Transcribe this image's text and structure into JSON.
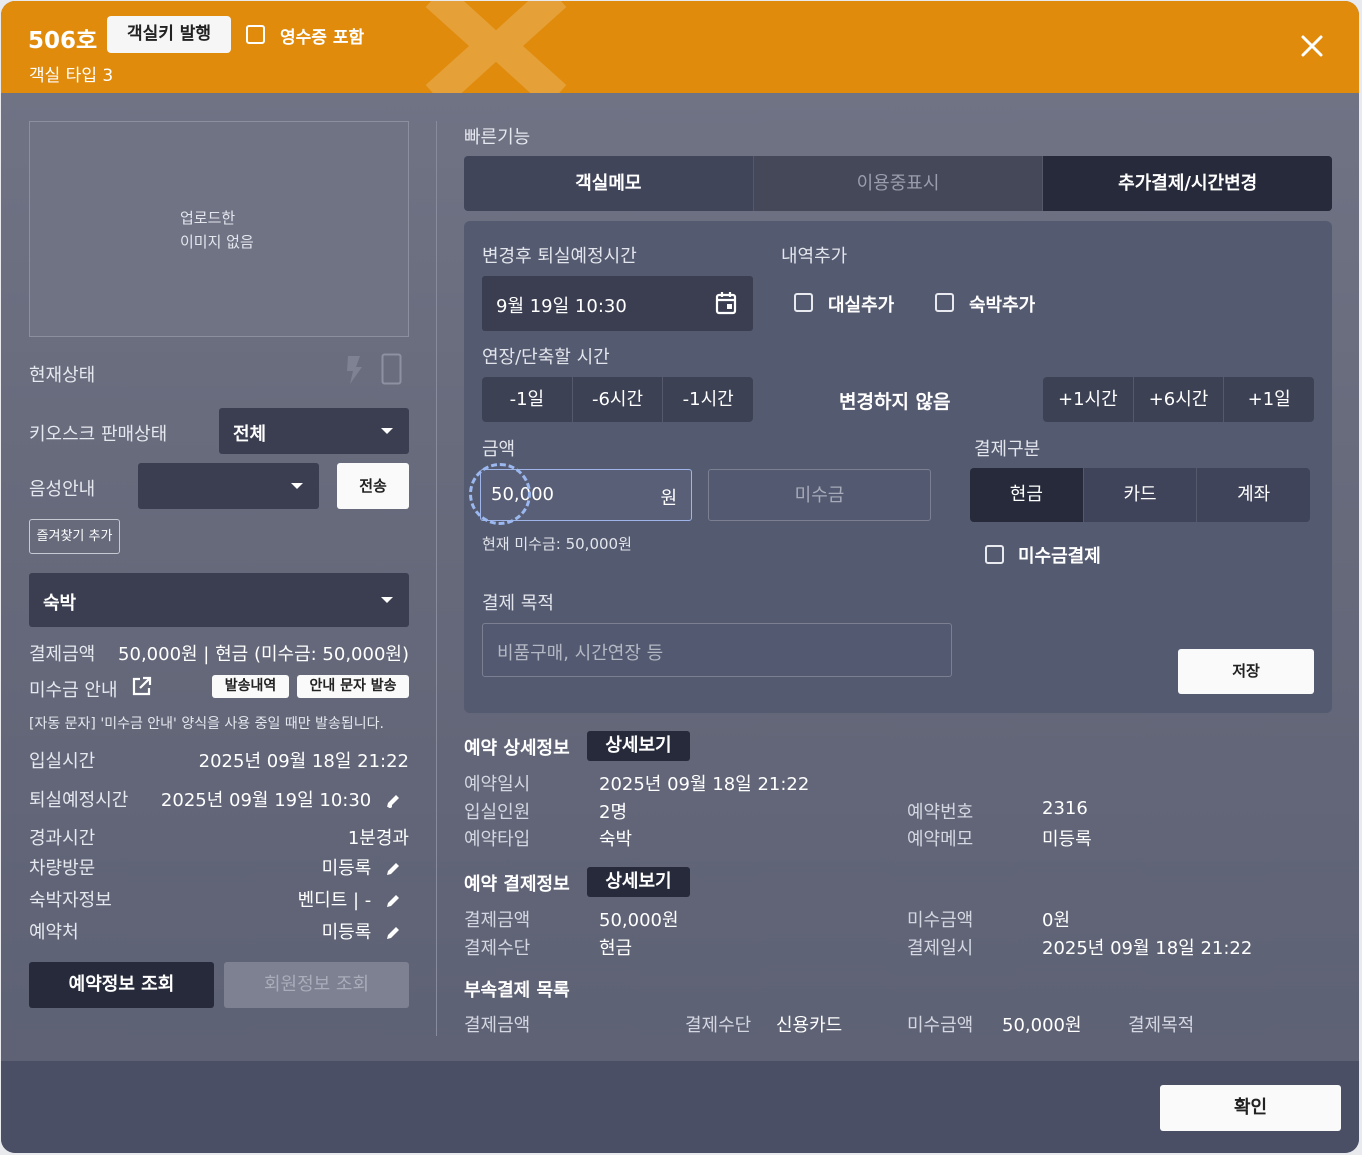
{
  "header": {
    "room_no": "506호",
    "issue_key_label": "객실키 발행",
    "receipt_label": "영수증 포함",
    "room_type": "객실 타입 3"
  },
  "left": {
    "image_placeholder": [
      "업로드한",
      "이미지 없음"
    ],
    "current_status_label": "현재상태",
    "kiosk_label": "키오스크 판매상태",
    "kiosk_value": "전체",
    "voice_label": "음성안내",
    "voice_value": "",
    "send_label": "전송",
    "favorite_label": "즐겨찾기 추가",
    "stay_type": "숙박",
    "payment_label": "결제금액",
    "payment_value": "50,000원 | 현금 (미수금: 50,000원)",
    "unpaid_notice_label": "미수금 안내",
    "send_history_label": "발송내역",
    "send_notice_label": "안내 문자 발송",
    "auto_sms_note": "[자동 문자] '미수금 안내' 양식을 사용 중일 때만 발송됩니다.",
    "checkin_label": "입실시간",
    "checkin_value": "2025년 09월 18일 21:22",
    "checkout_label": "퇴실예정시간",
    "checkout_value": "2025년 09월 19일 10:30",
    "elapsed_label": "경과시간",
    "elapsed_value": "1분경과",
    "vehicle_label": "차량방문",
    "vehicle_value": "미등록",
    "guest_label": "숙박자정보",
    "guest_value": "벤디트 | -",
    "channel_label": "예약처",
    "channel_value": "미등록",
    "reservation_btn": "예약정보 조회",
    "member_btn": "회원정보 조회"
  },
  "quick": {
    "title": "빠른기능",
    "tabs": [
      "객실메모",
      "이용중표시",
      "추가결제/시간변경"
    ],
    "checkout_after_label": "변경후 퇴실예정시간",
    "checkout_after_value": "9월 19일 10:30",
    "add_history_label": "내역추가",
    "add_rent_label": "대실추가",
    "add_stay_label": "숙박추가",
    "extend_label": "연장/단축할 시간",
    "minus_options": [
      "-1일",
      "-6시간",
      "-1시간"
    ],
    "no_change": "변경하지 않음",
    "plus_options": [
      "+1시간",
      "+6시간",
      "+1일"
    ],
    "amount_label": "금액",
    "amount_value": "50,000",
    "amount_unit": "원",
    "unpaid_placeholder": "미수금",
    "current_unpaid": "현재 미수금: 50,000원",
    "pay_type_label": "결제구분",
    "pay_types": [
      "현금",
      "카드",
      "계좌"
    ],
    "unpaid_pay_label": "미수금결제",
    "purpose_label": "결제 목적",
    "purpose_placeholder": "비품구매, 시간연장 등",
    "save_label": "저장"
  },
  "reservation": {
    "title": "예약 상세정보",
    "detail_btn": "상세보기",
    "date_label": "예약일시",
    "date_value": "2025년 09월 18일 21:22",
    "guests_label": "입실인원",
    "guests_value": "2명",
    "type_label": "예약타입",
    "type_value": "숙박",
    "number_label": "예약번호",
    "number_value": "2316",
    "memo_label": "예약메모",
    "memo_value": "미등록"
  },
  "payment": {
    "title": "예약 결제정보",
    "detail_btn": "상세보기",
    "amount_label": "결제금액",
    "amount_value": "50,000원",
    "method_label": "결제수단",
    "method_value": "현금",
    "unpaid_label": "미수금액",
    "unpaid_value": "0원",
    "date_label": "결제일시",
    "date_value": "2025년 09월 18일 21:22"
  },
  "sub_payment": {
    "title": "부속결제 목록",
    "amount_label": "결제금액",
    "method_label": "결제수단",
    "method_value": "신용카드",
    "unpaid_label": "미수금액",
    "unpaid_value": "50,000원",
    "purpose_label": "결제목적"
  },
  "footer": {
    "confirm_label": "확인"
  },
  "colors": {
    "header": "#e08b0c",
    "dark": "#262a3a",
    "panel": "#545a70"
  }
}
